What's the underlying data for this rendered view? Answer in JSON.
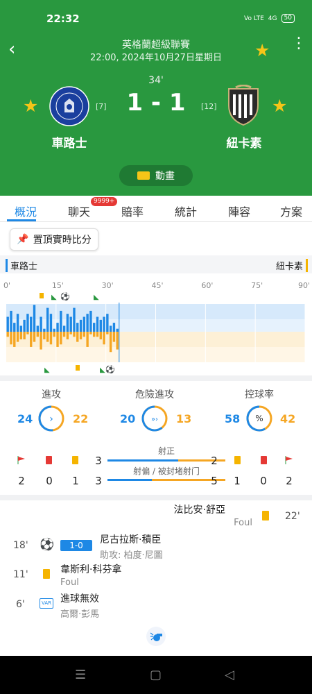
{
  "status_bar": {
    "time": "22:32",
    "net1": "Vo LTE",
    "net2": "4G",
    "battery": "50"
  },
  "header": {
    "league": "英格蘭超級聯賽",
    "datetime": "22:00, 2024年10月27日星期日",
    "minute": "34'",
    "score": "1 - 1",
    "home": {
      "name": "車路士",
      "rank": "[7]"
    },
    "away": {
      "name": "紐卡素",
      "rank": "[12]"
    },
    "animation_label": "動畫"
  },
  "tabs": [
    {
      "label": "概況"
    },
    {
      "label": "聊天",
      "badge": "9999+"
    },
    {
      "label": "賠率"
    },
    {
      "label": "統計"
    },
    {
      "label": "陣容"
    },
    {
      "label": "方案"
    }
  ],
  "pin_label": "置頂實時比分",
  "timeline": {
    "home": "車路士",
    "away": "紐卡素",
    "ticks": [
      "0'",
      "15'",
      "30'",
      "45'",
      "60'",
      "75'",
      "90'"
    ],
    "current_minute": 34,
    "home_pressure": [
      5,
      7,
      3,
      6,
      2,
      4,
      6,
      5,
      9,
      2,
      5,
      1,
      8,
      6,
      1,
      3,
      7,
      2,
      6,
      5,
      8,
      3,
      4,
      5,
      6,
      7,
      3,
      5,
      4,
      5,
      6,
      2,
      3,
      1
    ],
    "away_pressure": [
      2,
      5,
      6,
      4,
      3,
      3,
      1,
      6,
      4,
      2,
      7,
      3,
      4,
      5,
      2,
      6,
      5,
      2,
      3,
      1,
      2,
      4,
      3,
      2,
      6,
      1,
      2,
      2,
      3,
      5,
      1,
      8,
      4,
      7
    ]
  },
  "stats": {
    "attack": {
      "label": "進攻",
      "home": "24",
      "away": "22",
      "icon": "chevron-right-icon"
    },
    "danger": {
      "label": "危險進攻",
      "home": "20",
      "away": "13",
      "icon": "triple-chevron-icon"
    },
    "possession": {
      "label": "控球率",
      "home": "58",
      "away": "42",
      "icon": "percent-icon"
    },
    "corners": {
      "home": "2",
      "away": "2"
    },
    "red": {
      "home": "0",
      "away": "0"
    },
    "yellow": {
      "home": "1",
      "away": "1"
    },
    "on_target": {
      "label": "射正",
      "home": "3",
      "away": "2"
    },
    "off_target": {
      "label": "射偏 / 被封堵射门",
      "home": "3",
      "away": "5"
    }
  },
  "events": [
    {
      "minute": "22'",
      "side": "away",
      "type": "yellow",
      "player": "法比安·舒亞",
      "detail": "Foul"
    },
    {
      "minute": "18'",
      "side": "home",
      "type": "goal",
      "score": "1-0",
      "player": "尼古拉斯·積臣",
      "detail": "助攻: 柏度·尼圖"
    },
    {
      "minute": "11'",
      "side": "home",
      "type": "yellow",
      "player": "韋斯利·科芬拿",
      "detail": "Foul"
    },
    {
      "minute": "6'",
      "side": "home",
      "type": "var",
      "player": "進球無效",
      "detail": "高爾·彭馬"
    }
  ],
  "colors": {
    "header": "#29983f",
    "home": "#1e88e5",
    "away": "#f5a623",
    "star": "#f5c518"
  }
}
